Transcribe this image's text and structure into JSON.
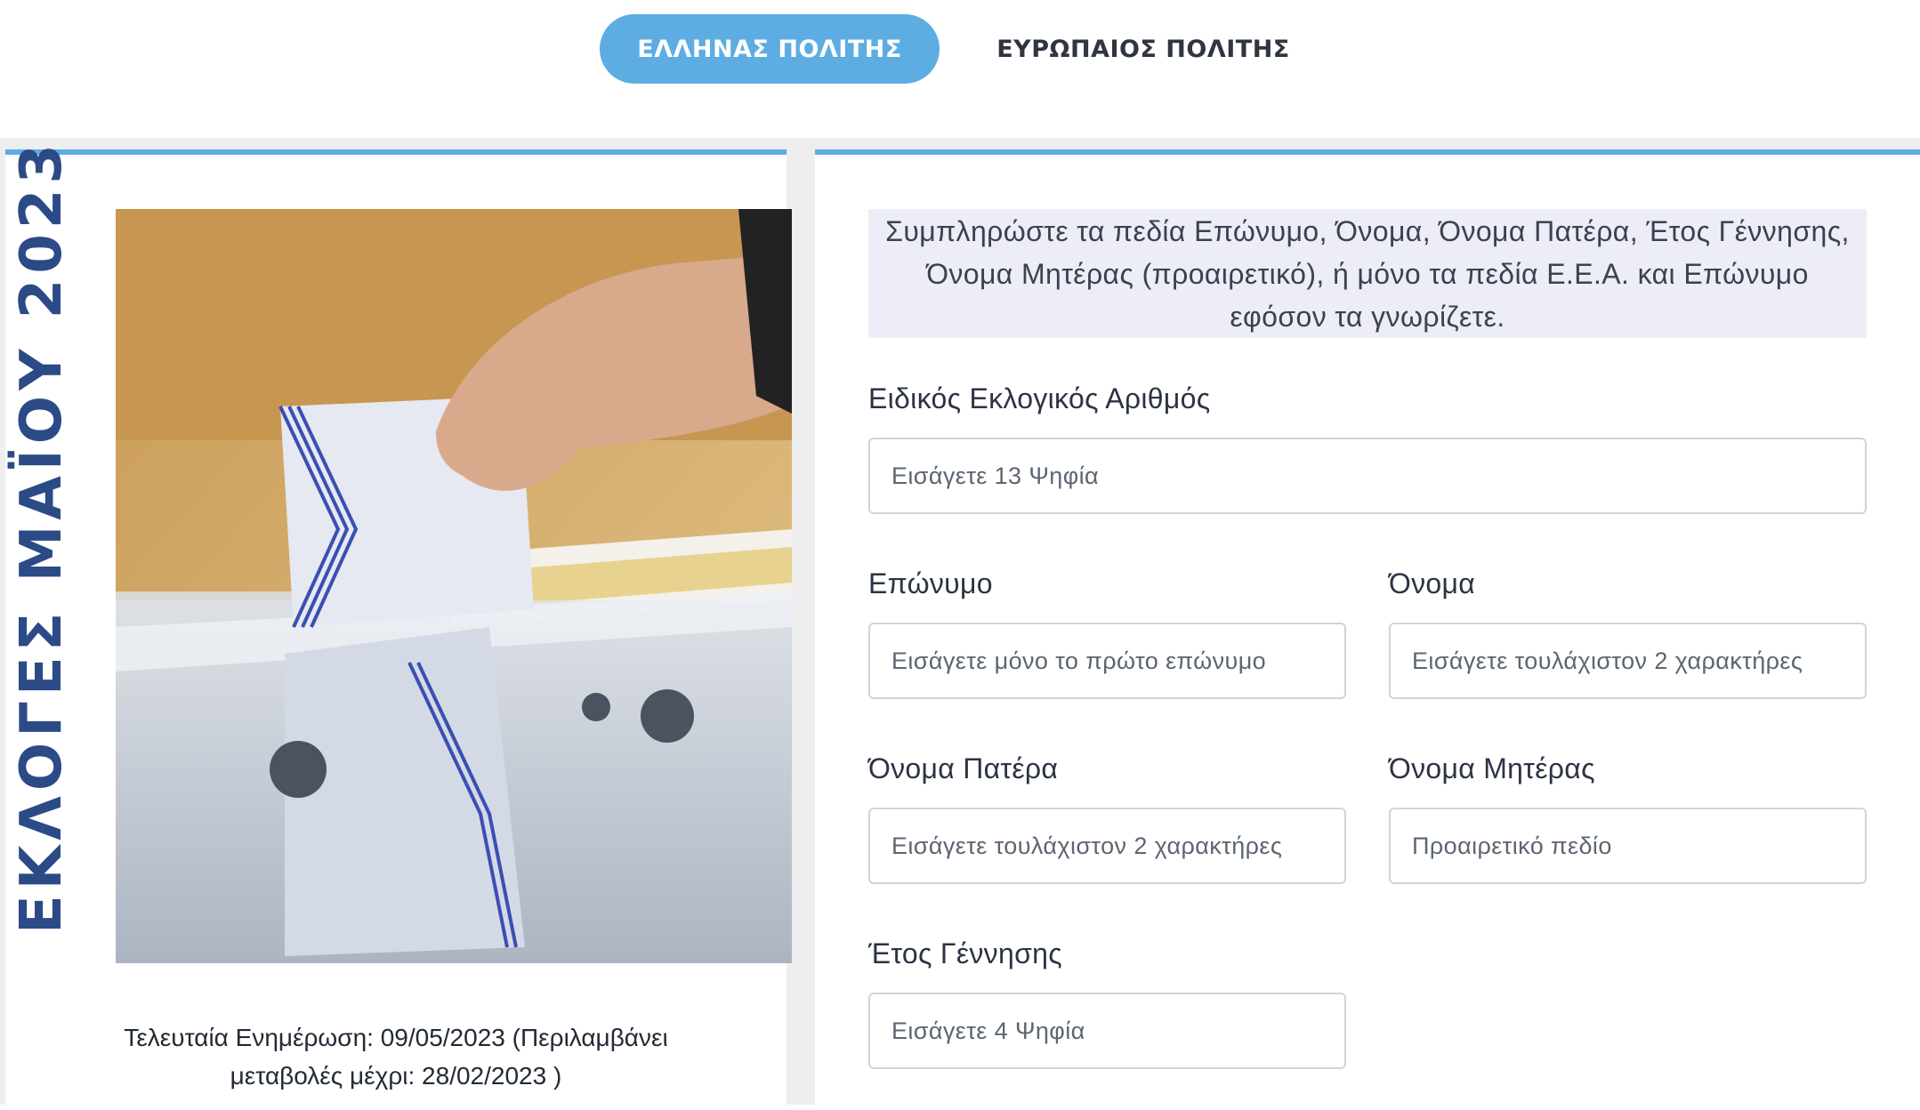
{
  "tabs": {
    "greek_citizen": "ΕΛΛΗΝΑΣ ΠΟΛΙΤΗΣ",
    "european_citizen": "ΕΥΡΩΠΑΙΟΣ ΠΟΛΙΤΗΣ"
  },
  "left_panel": {
    "vertical_title": "ΕΚΛΟΓΕΣ ΜΑΪΟΥ 2023",
    "update_line1": "Τελευταία Ενημέρωση: 09/05/2023 (Περιλαμβάνει",
    "update_line2": "μεταβολές μέχρι: 28/02/2023 )"
  },
  "form": {
    "info_text": "Συμπληρώστε τα πεδία Επώνυμο, Όνομα, Όνομα Πατέρα, Έτος Γέννησης, Όνομα Μητέρας (προαιρετικό), ή μόνο τα πεδία Ε.Ε.Α. και Επώνυμο εφόσον τα γνωρίζετε.",
    "special_number": {
      "label": "Ειδικός Εκλογικός Αριθμός",
      "placeholder": "Εισάγετε 13 Ψηφία"
    },
    "surname": {
      "label": "Επώνυμο",
      "placeholder": "Εισάγετε μόνο το πρώτο επώνυμο"
    },
    "first_name": {
      "label": "Όνομα",
      "placeholder": "Εισάγετε τουλάχιστον 2 χαρακτήρες"
    },
    "father_name": {
      "label": "Όνομα Πατέρα",
      "placeholder": "Εισάγετε τουλάχιστον 2 χαρακτήρες"
    },
    "mother_name": {
      "label": "Όνομα Μητέρας",
      "placeholder": "Προαιρετικό πεδίο"
    },
    "birth_year": {
      "label": "Έτος Γέννησης",
      "placeholder": "Εισάγετε 4 Ψηφία"
    }
  },
  "colors": {
    "accent": "#5dade2",
    "title_blue": "#2c4a86",
    "info_bg": "#ededf7"
  }
}
